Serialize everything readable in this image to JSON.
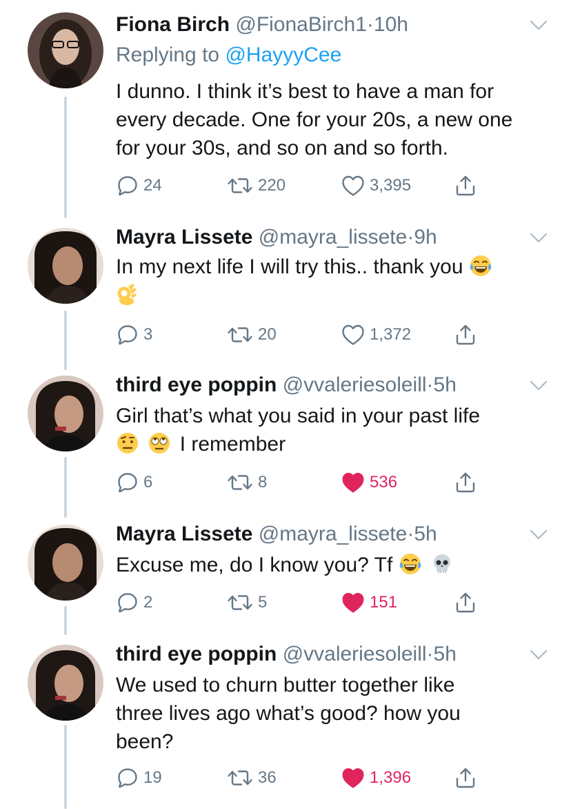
{
  "tweets": [
    {
      "name": "Fiona Birch",
      "handle": "@FionaBirch1",
      "dot": "·",
      "time": "10h",
      "replying_label": "Replying to",
      "replying_mention": "@HayyyCee",
      "text_lines": [
        "I dunno. I think it’s best to have a man for",
        "every decade. One for your 20s, a new one",
        "for your 30s, and so on and so forth."
      ],
      "replies": "24",
      "retweets": "220",
      "likes": "3,395",
      "liked": false,
      "avatar_colors": [
        "#3b2a24",
        "#c8a896"
      ]
    },
    {
      "name": "Mayra Lissete",
      "handle": "@mayra_lissete",
      "dot": "·",
      "time": "9h",
      "text_lines": [
        "In my next life I will try this.. thank you"
      ],
      "emojis": [
        "face-with-tears-of-joy",
        "ok-hand"
      ],
      "replies": "3",
      "retweets": "20",
      "likes": "1,372",
      "liked": false,
      "avatar_colors": [
        "#201815",
        "#b88a72"
      ]
    },
    {
      "name": "third eye poppin",
      "handle": "@vvaleriesoleill",
      "dot": "·",
      "time": "5h",
      "text_lines": [
        "Girl that’s what you said in your past life",
        "I remember"
      ],
      "emojis": [
        "face-with-raised-eyebrow",
        "face-with-rolling-eyes"
      ],
      "replies": "6",
      "retweets": "8",
      "likes": "536",
      "liked": true,
      "avatar_colors": [
        "#2a1f1c",
        "#c49a82"
      ]
    },
    {
      "name": "Mayra Lissete",
      "handle": "@mayra_lissete",
      "dot": "·",
      "time": "5h",
      "text_lines": [
        "Excuse me, do I know you? Tf"
      ],
      "emojis": [
        "face-with-tears-of-joy",
        "skull"
      ],
      "replies": "2",
      "retweets": "5",
      "likes": "151",
      "liked": true,
      "avatar_colors": [
        "#201815",
        "#b88a72"
      ]
    },
    {
      "name": "third eye poppin",
      "handle": "@vvaleriesoleill",
      "dot": "·",
      "time": "5h",
      "text_lines": [
        "We used to churn butter together like",
        "three lives ago what’s good? how you",
        "been?"
      ],
      "replies": "19",
      "retweets": "36",
      "likes": "1,396",
      "liked": true,
      "avatar_colors": [
        "#2a1f1c",
        "#c49a82"
      ]
    }
  ],
  "colors": {
    "text": "#14171a",
    "secondary": "#657786",
    "link": "#1da1f2",
    "like": "#e0245e",
    "thread_line": "#ccd6dd"
  },
  "icons": [
    "reply-icon",
    "retweet-icon",
    "like-icon",
    "share-icon",
    "chevron-down-icon"
  ]
}
